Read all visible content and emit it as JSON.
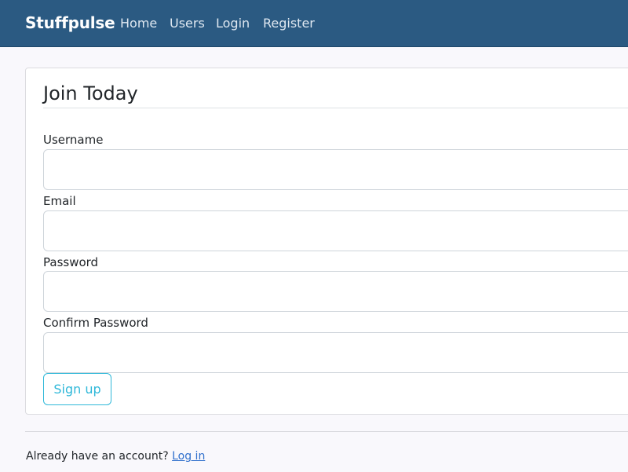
{
  "navbar": {
    "brand": "Stuffpulse",
    "links": [
      "Home",
      "Users",
      "Login",
      "Register"
    ]
  },
  "form": {
    "legend": "Join Today",
    "fields": [
      {
        "label": "Username",
        "value": "",
        "placeholder": ""
      },
      {
        "label": "Email",
        "value": "",
        "placeholder": ""
      },
      {
        "label": "Password",
        "value": "",
        "placeholder": ""
      },
      {
        "label": "Confirm Password",
        "value": "",
        "placeholder": ""
      }
    ],
    "submit_label": "Sign up"
  },
  "footer": {
    "prompt": "Already have an account? ",
    "login_link": "Log in"
  },
  "colors": {
    "navbar_bg": "#2b5a82",
    "button_accent": "#2fb8d9",
    "link": "#2f6fcc",
    "page_bg": "#f9f8fc"
  }
}
